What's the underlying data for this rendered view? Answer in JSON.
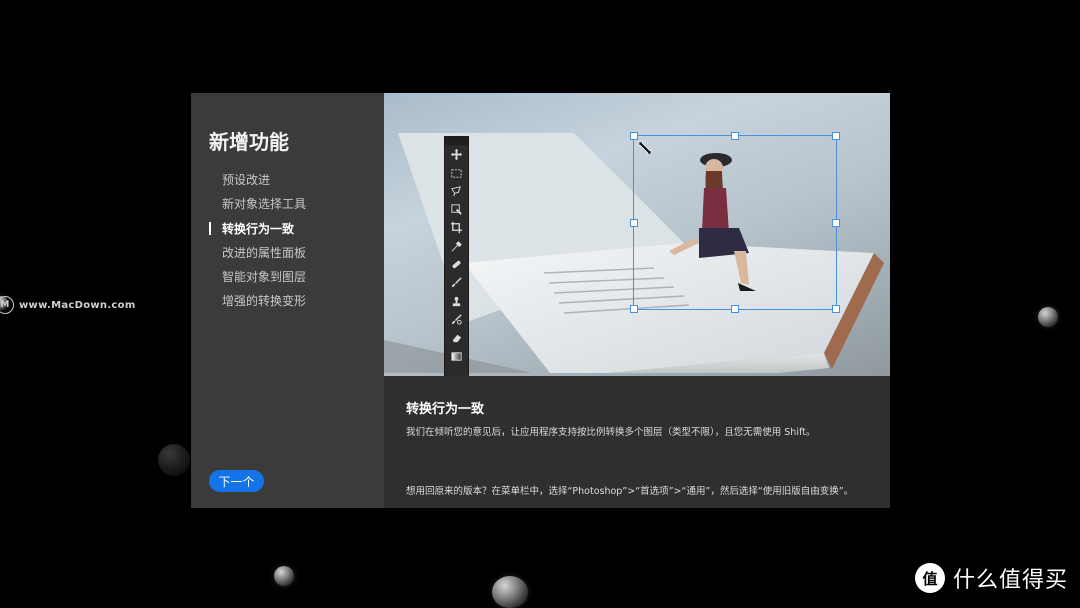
{
  "watermark": {
    "text": "www.MacDown.com"
  },
  "dialog": {
    "title": "新增功能",
    "nav": [
      {
        "label": "预设改进",
        "active": false
      },
      {
        "label": "新对象选择工具",
        "active": false
      },
      {
        "label": "转换行为一致",
        "active": true
      },
      {
        "label": "改进的属性面板",
        "active": false
      },
      {
        "label": "智能对象到图层",
        "active": false
      },
      {
        "label": "增强的转换变形",
        "active": false
      }
    ],
    "next_label": "下一个",
    "feature": {
      "heading": "转换行为一致",
      "description": "我们在倾听您的意见后，让应用程序支持按比例转换多个图层（类型不限），且您无需使用 Shift。",
      "tip": "想用回原来的版本？在菜单栏中，选择“Photoshop”>“首选项”>“通用”，然后选择“使用旧版自由变换”。"
    }
  },
  "brand": {
    "icon": "值",
    "text": "什么值得买"
  },
  "colors": {
    "accent": "#1473e6",
    "selection": "#4a90e2"
  }
}
